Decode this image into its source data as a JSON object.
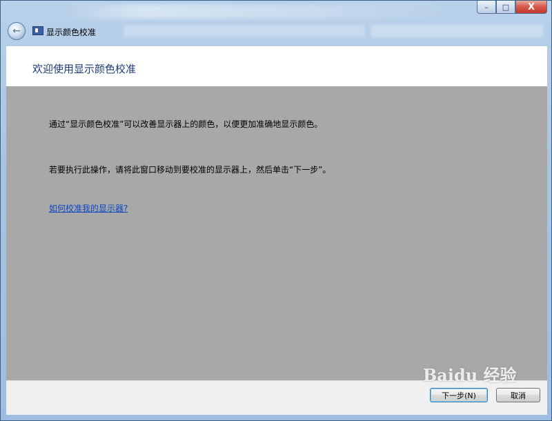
{
  "window": {
    "caption_buttons": {
      "minimize": "–",
      "maximize": "□",
      "close": "X"
    }
  },
  "nav": {
    "back_icon": "back-arrow-icon",
    "app_icon": "display-calibration-icon",
    "title": "显示颜色校准"
  },
  "header": {
    "title": "欢迎使用显示颜色校准"
  },
  "main": {
    "intro": "通过“显示颜色校准”可以改善显示器上的颜色，以便更加准确地显示颜色。",
    "instruction": "若要执行此操作，请将此窗口移动到要校准的显示器上，然后单击“下一步”。",
    "help_link": "如何校准我的显示器?"
  },
  "footer": {
    "next_label": "下一步(N)",
    "cancel_label": "取消"
  },
  "watermark": "Baidu 经验",
  "colors": {
    "content_bg": "#a8a8a8",
    "header_title": "#1d3a7a",
    "link": "#0a47c2"
  }
}
